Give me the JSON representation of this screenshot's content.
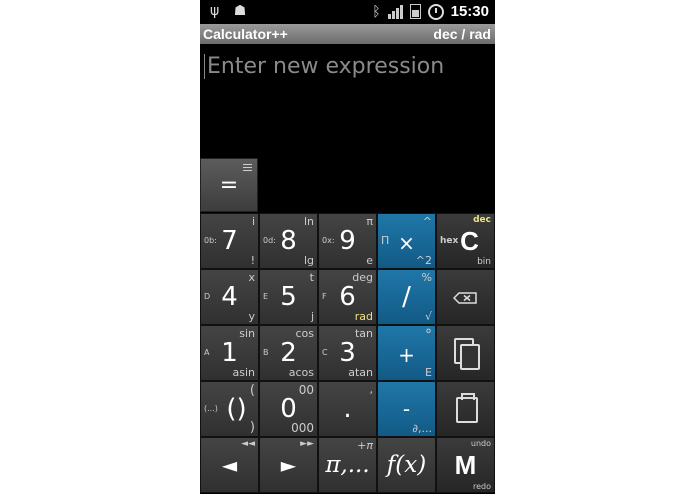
{
  "status_bar": {
    "time": "15:30",
    "icons": [
      "usb-icon",
      "android-debug-icon",
      "bluetooth-icon",
      "signal-icon",
      "battery-icon",
      "alarm-clock-icon"
    ]
  },
  "app": {
    "title": "Calculator++",
    "mode": "dec / rad"
  },
  "expression": {
    "placeholder": "Enter new expression",
    "value": ""
  },
  "equals": {
    "label": "=",
    "menu_icon": "menu-lines-icon"
  },
  "keys": {
    "seven": {
      "main": "7",
      "top": "i",
      "bottom": "!",
      "left": "0b:"
    },
    "eight": {
      "main": "8",
      "top": "ln",
      "bottom": "lg",
      "left": "0d:"
    },
    "nine": {
      "main": "9",
      "top": "π",
      "bottom": "e",
      "left": "0x:"
    },
    "multiply": {
      "main": "×",
      "top": "^",
      "bottom": "^2",
      "left": "Π"
    },
    "clear": {
      "main": "C",
      "top": "dec",
      "bottom": "bin",
      "left": "hex"
    },
    "four": {
      "main": "4",
      "top": "x",
      "bottom": "y",
      "left": "D"
    },
    "five": {
      "main": "5",
      "top": "t",
      "bottom": "j",
      "left": "E"
    },
    "six": {
      "main": "6",
      "top": "deg",
      "bottom": "rad",
      "left": "F"
    },
    "divide": {
      "main": "/",
      "top": "%",
      "bottom": "√"
    },
    "backspace": {
      "icon": "backspace-icon"
    },
    "one": {
      "main": "1",
      "top": "sin",
      "bottom": "asin",
      "left": "A"
    },
    "two": {
      "main": "2",
      "top": "cos",
      "bottom": "acos",
      "left": "B"
    },
    "three": {
      "main": "3",
      "top": "tan",
      "bottom": "atan",
      "left": "C"
    },
    "plus": {
      "main": "+",
      "top": "°",
      "bottom": "E"
    },
    "copy": {
      "icon": "copy-icon"
    },
    "brackets": {
      "main": "()",
      "top": "(",
      "bottom": ")",
      "left": "(...)"
    },
    "zero": {
      "main": "0",
      "top": "00",
      "bottom": "000"
    },
    "dot": {
      "main": ".",
      "top": ","
    },
    "minus": {
      "main": "-",
      "bottom": "∂,..."
    },
    "paste": {
      "icon": "paste-icon"
    },
    "left": {
      "main": "◄",
      "top": "◄◄"
    },
    "right": {
      "main": "►",
      "top": "►►"
    },
    "constants": {
      "main": "π,...",
      "top": "+π"
    },
    "functions": {
      "main": "f(x)"
    },
    "memory": {
      "main": "M",
      "top": "undo",
      "bottom": "redo"
    }
  }
}
